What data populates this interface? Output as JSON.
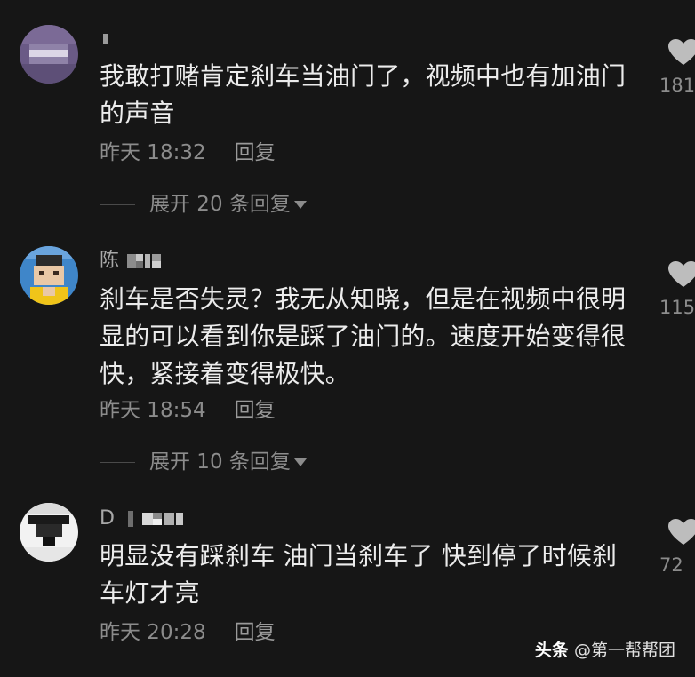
{
  "comments": [
    {
      "username": "",
      "text": "我敢打赌肯定刹车当油门了，视频中也有加油门的声音",
      "time": "昨天 18:32",
      "reply_label": "回复",
      "like_count": "181",
      "expand_label": "展开 20 条回复"
    },
    {
      "username": "陈",
      "text": "刹车是否失灵？我无从知晓，但是在视频中很明显的可以看到你是踩了油门的。速度开始变得很快，紧接着变得极快。",
      "time": "昨天 18:54",
      "reply_label": "回复",
      "like_count": "115",
      "expand_label": "展开 10 条回复"
    },
    {
      "username": "D",
      "text": "明显没有踩刹车 油门当刹车了 快到停了时候刹车灯才亮",
      "time": "昨天 20:28",
      "reply_label": "回复",
      "like_count": "72"
    }
  ],
  "watermark": {
    "brand": "头条",
    "handle": "@第一帮帮团"
  },
  "icons": {
    "like": "heart-icon",
    "expand_caret": "caret-down-icon"
  },
  "colors": {
    "background": "#161616",
    "text": "#ececec",
    "secondary": "#8c8c8c"
  }
}
